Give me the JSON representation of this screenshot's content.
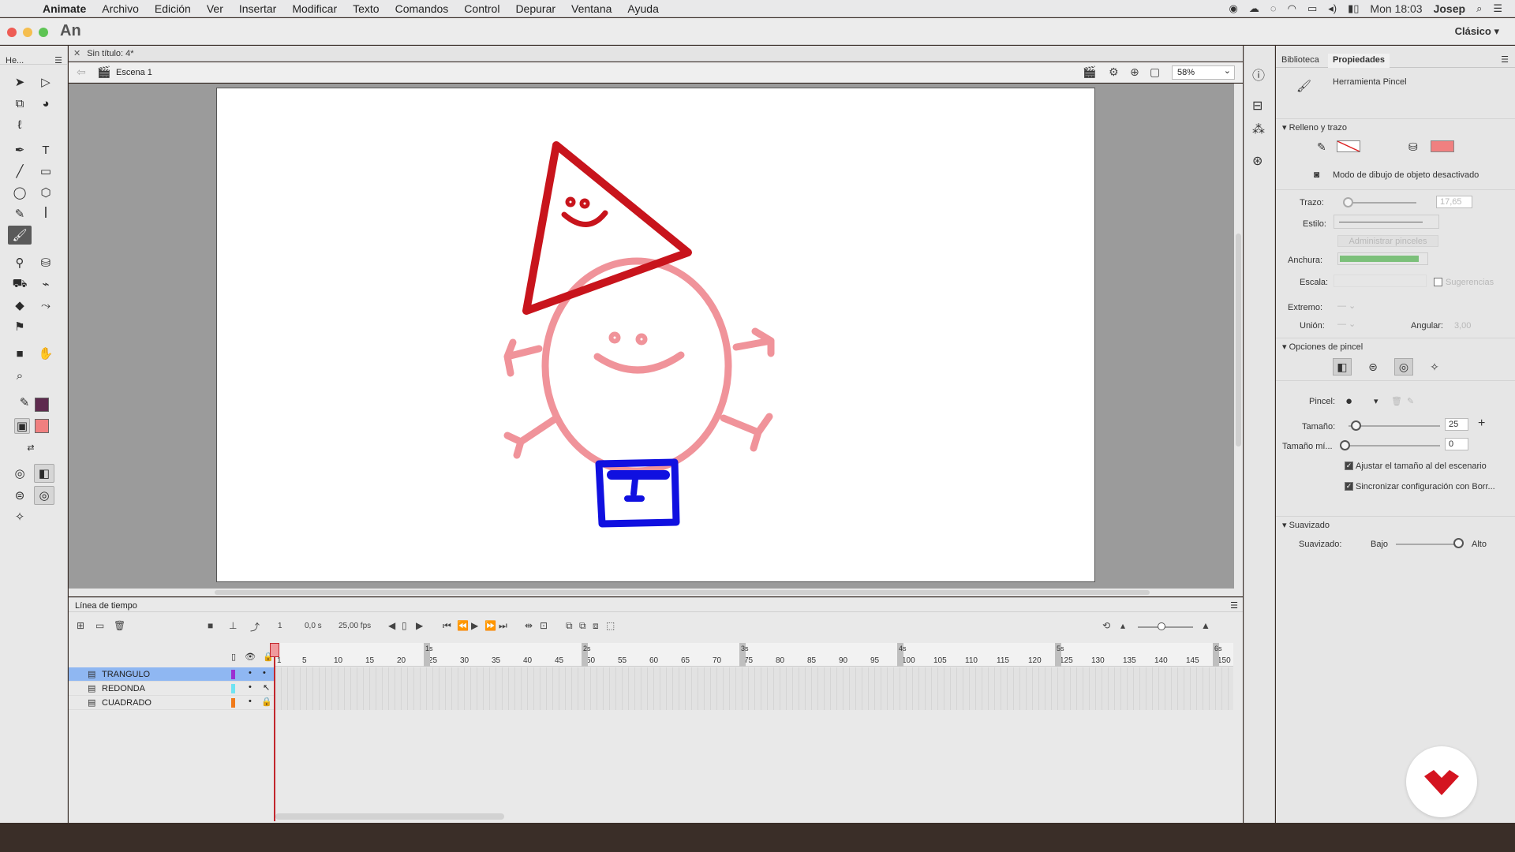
{
  "menubar": {
    "app_name": "Animate",
    "menus": [
      "Archivo",
      "Edición",
      "Ver",
      "Insertar",
      "Modificar",
      "Texto",
      "Comandos",
      "Control",
      "Depurar",
      "Ventana",
      "Ayuda"
    ],
    "clock": "Mon 18:03",
    "user": "Josep"
  },
  "titlebar": {
    "app_logo": "An",
    "workspace": "Clásico"
  },
  "tools_panel": {
    "title": "He..."
  },
  "document": {
    "tab_title": "Sin título: 4*",
    "scene": "Escena 1",
    "zoom": "58%"
  },
  "timeline": {
    "title": "Línea de tiempo",
    "current_frame": "1",
    "time": "0,0 s",
    "fps": "25,00 fps",
    "seconds": [
      "1s",
      "2s",
      "3s",
      "4s",
      "5s",
      "6s"
    ],
    "frame_numbers": [
      "1",
      "5",
      "10",
      "15",
      "20",
      "25",
      "30",
      "35",
      "40",
      "45",
      "50",
      "55",
      "60",
      "65",
      "70",
      "75",
      "80",
      "85",
      "90",
      "95",
      "100",
      "105",
      "110",
      "115",
      "120",
      "125",
      "130",
      "135",
      "140",
      "145",
      "150"
    ],
    "layers": [
      {
        "name": "TRANGULO",
        "color": "#9b2fd1",
        "selected": true,
        "locked": false
      },
      {
        "name": "REDONDA",
        "color": "#6fe3f2",
        "selected": false,
        "locked": false
      },
      {
        "name": "CUADRADO",
        "color": "#f07a1a",
        "selected": false,
        "locked": true
      }
    ]
  },
  "properties": {
    "tabs": [
      "Biblioteca",
      "Propiedades"
    ],
    "active_tab": "Propiedades",
    "tool_name": "Herramienta Pincel",
    "fill_stroke": {
      "title": "Relleno y trazo",
      "fill_color": "#f08080",
      "object_drawing_mode": "Modo de dibujo de objeto desactivado"
    },
    "stroke": {
      "trazo_label": "Trazo:",
      "trazo_value": "17,65",
      "estilo_label": "Estilo:",
      "manage_brushes": "Administrar pinceles",
      "anchura_label": "Anchura:",
      "escala_label": "Escala:",
      "sugerencias": "Sugerencias",
      "extremo_label": "Extremo:",
      "union_label": "Unión:",
      "angular_label": "Angular:",
      "angular_value": "3,00"
    },
    "brush_options": {
      "title": "Opciones de pincel",
      "pincel_label": "Pincel:",
      "tamano_label": "Tamaño:",
      "tamano_value": "25",
      "tamano_min_label": "Tamaño mí...",
      "tamano_min_value": "0",
      "adjust_stage": "Ajustar el tamaño al del escenario",
      "sync_eraser": "Sincronizar configuración con Borr..."
    },
    "smoothing": {
      "title": "Suavizado",
      "label": "Suavizado:",
      "low": "Bajo",
      "high": "Alto"
    }
  },
  "colors": {
    "stroke_color": "#5e2a4e",
    "fill_color": "#f08080",
    "triangle": "#c8141c",
    "circle": "#f0939a",
    "square": "#1010e0"
  }
}
